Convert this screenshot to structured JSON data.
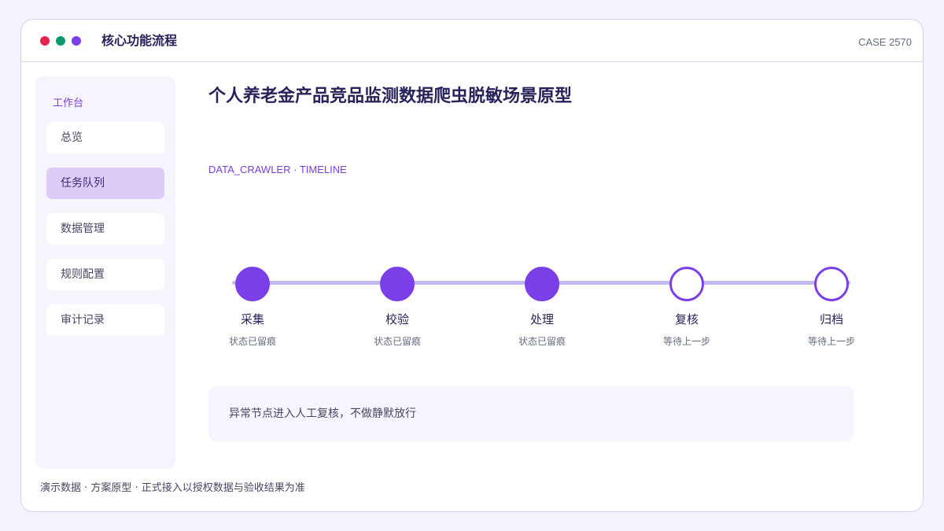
{
  "window": {
    "title": "核心功能流程",
    "case_id": "CASE 2570",
    "dots": [
      {
        "name": "red",
        "color": "#e0264a"
      },
      {
        "name": "green",
        "color": "#0f9a6e"
      },
      {
        "name": "purple",
        "color": "#7a3fe6"
      }
    ]
  },
  "sidebar": {
    "heading": "工作台",
    "items": [
      {
        "label": "总览",
        "active": false
      },
      {
        "label": "任务队列",
        "active": true
      },
      {
        "label": "数据管理",
        "active": false
      },
      {
        "label": "规则配置",
        "active": false
      },
      {
        "label": "审计记录",
        "active": false
      }
    ]
  },
  "main": {
    "title": "个人养老金产品竞品监测数据爬虫脱敏场景原型",
    "subtitle": "DATA_CRAWLER · TIMELINE",
    "timeline": [
      {
        "label": "采集",
        "status": "状态已留痕",
        "done": true
      },
      {
        "label": "校验",
        "status": "状态已留痕",
        "done": true
      },
      {
        "label": "处理",
        "status": "状态已留痕",
        "done": true
      },
      {
        "label": "复核",
        "status": "等待上一步",
        "done": false
      },
      {
        "label": "归档",
        "status": "等待上一步",
        "done": false
      }
    ],
    "notice": "异常节点进入人工复核，不做静默放行"
  },
  "footer": "演示数据 · 方案原型 · 正式接入以授权数据与验收结果为准",
  "colors": {
    "accent": "#7a3fe6",
    "track": "#c6b8f3",
    "active_nav": "#dcccf8"
  }
}
